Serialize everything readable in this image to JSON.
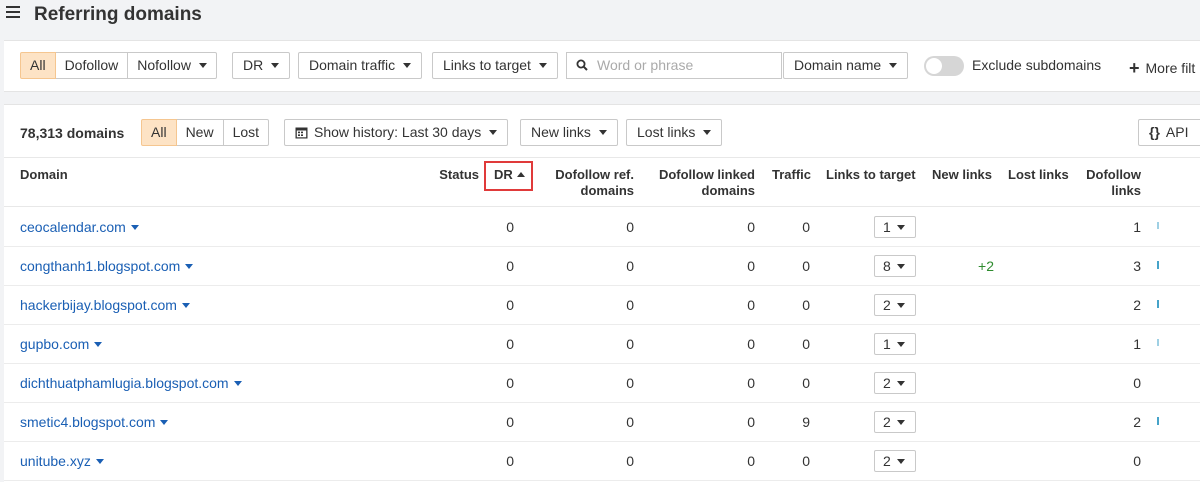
{
  "header": {
    "title": "Referring domains"
  },
  "filters": {
    "link_type": [
      "All",
      "Dofollow",
      "Nofollow"
    ],
    "dr_label": "DR",
    "domain_traffic_label": "Domain traffic",
    "links_to_target_label": "Links to target",
    "search_placeholder": "Word or phrase",
    "search_scope": "Domain name",
    "exclude_subdomains_label": "Exclude subdomains",
    "more_filters_label": "More filt"
  },
  "toolbar": {
    "count": "78,313 domains",
    "status_tabs": [
      "All",
      "New",
      "Lost"
    ],
    "history_label": "Show history: Last 30 days",
    "new_links_label": "New links",
    "lost_links_label": "Lost links",
    "api_label": "API"
  },
  "table": {
    "headers": {
      "domain": "Domain",
      "status": "Status",
      "dr": "DR",
      "dofollow_ref_domains": [
        "Dofollow ref.",
        "domains"
      ],
      "dofollow_linked_domains": [
        "Dofollow linked",
        "domains"
      ],
      "traffic": "Traffic",
      "links_to_target": "Links to target",
      "new_links": "New links",
      "lost_links": "Lost links",
      "dofollow_links": [
        "Dofollow",
        "links"
      ]
    },
    "rows": [
      {
        "domain": "ceocalendar.com",
        "dr": "0",
        "dofollow_ref": "0",
        "dofollow_linked": "0",
        "traffic": "0",
        "links_to_target": "1",
        "new_links": "",
        "dofollow_links": "1",
        "spark": "light"
      },
      {
        "domain": "congthanh1.blogspot.com",
        "dr": "0",
        "dofollow_ref": "0",
        "dofollow_linked": "0",
        "traffic": "0",
        "links_to_target": "8",
        "new_links": "+2",
        "dofollow_links": "3",
        "spark": "dark"
      },
      {
        "domain": "hackerbijay.blogspot.com",
        "dr": "0",
        "dofollow_ref": "0",
        "dofollow_linked": "0",
        "traffic": "0",
        "links_to_target": "2",
        "new_links": "",
        "dofollow_links": "2",
        "spark": "dark"
      },
      {
        "domain": "gupbo.com",
        "dr": "0",
        "dofollow_ref": "0",
        "dofollow_linked": "0",
        "traffic": "0",
        "links_to_target": "1",
        "new_links": "",
        "dofollow_links": "1",
        "spark": "light"
      },
      {
        "domain": "dichthuatphamlugia.blogspot.com",
        "dr": "0",
        "dofollow_ref": "0",
        "dofollow_linked": "0",
        "traffic": "0",
        "links_to_target": "2",
        "new_links": "",
        "dofollow_links": "0",
        "spark": "none"
      },
      {
        "domain": "smetic4.blogspot.com",
        "dr": "0",
        "dofollow_ref": "0",
        "dofollow_linked": "0",
        "traffic": "9",
        "links_to_target": "2",
        "new_links": "",
        "dofollow_links": "2",
        "spark": "dark"
      },
      {
        "domain": "unitube.xyz",
        "dr": "0",
        "dofollow_ref": "0",
        "dofollow_linked": "0",
        "traffic": "0",
        "links_to_target": "2",
        "new_links": "",
        "dofollow_links": "0",
        "spark": "none"
      }
    ]
  },
  "colors": {
    "accent_active": "#fde3c5",
    "link": "#1a5fb4",
    "positive": "#2e8b2e",
    "highlight_border": "#e03a3a"
  },
  "icons": {
    "menu": "hamburger-icon",
    "search": "search-icon",
    "calendar": "calendar-icon",
    "plus": "plus-icon",
    "api": "braces-icon"
  }
}
